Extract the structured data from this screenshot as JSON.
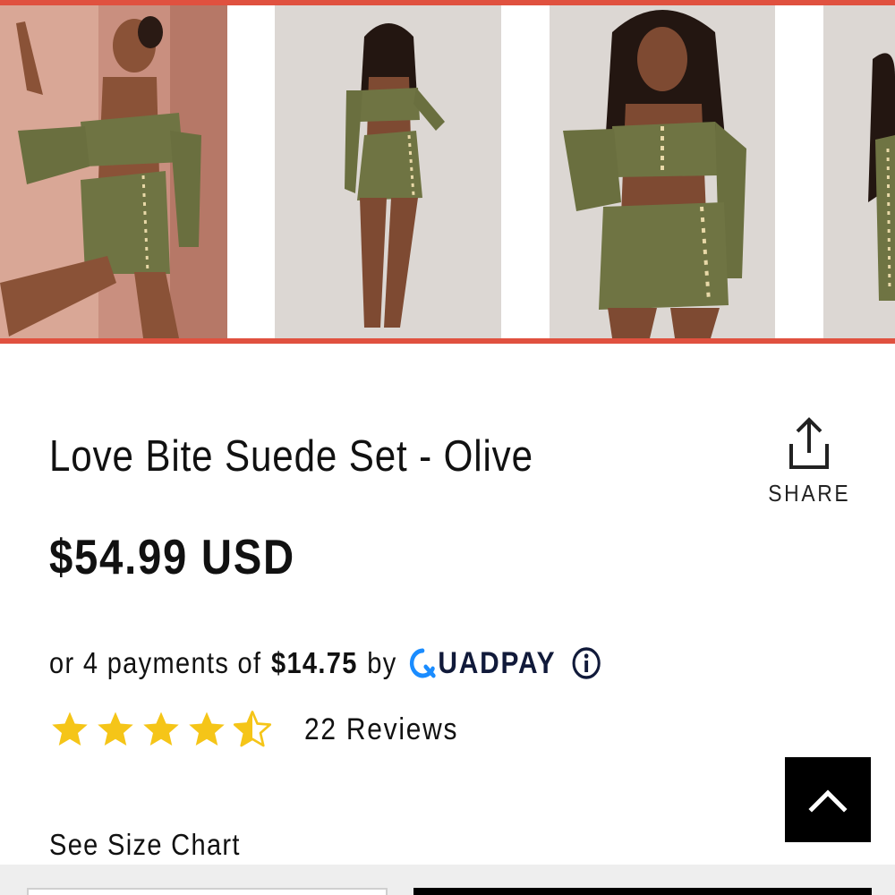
{
  "product": {
    "title": "Love Bite Suede Set - Olive",
    "price": "$54.99 USD"
  },
  "share": {
    "label": "SHARE",
    "icon": "share-icon"
  },
  "installments": {
    "lead": "or 4 payments of",
    "amount": "$14.75",
    "by": "by",
    "provider": "UADPAY",
    "provider_icon": "quadpay-q-icon",
    "info_icon": "info-icon"
  },
  "rating": {
    "stars": 4.5,
    "max": 5,
    "reviews_label": "22 Reviews",
    "star_color": "#f5c518"
  },
  "size_chart": {
    "label": "See Size Chart"
  },
  "back_to_top": {
    "icon": "chevron-up-icon"
  },
  "colors": {
    "accent": "#e0513f",
    "quadpay_blue": "#1a8cff",
    "quadpay_text": "#111a3a"
  }
}
